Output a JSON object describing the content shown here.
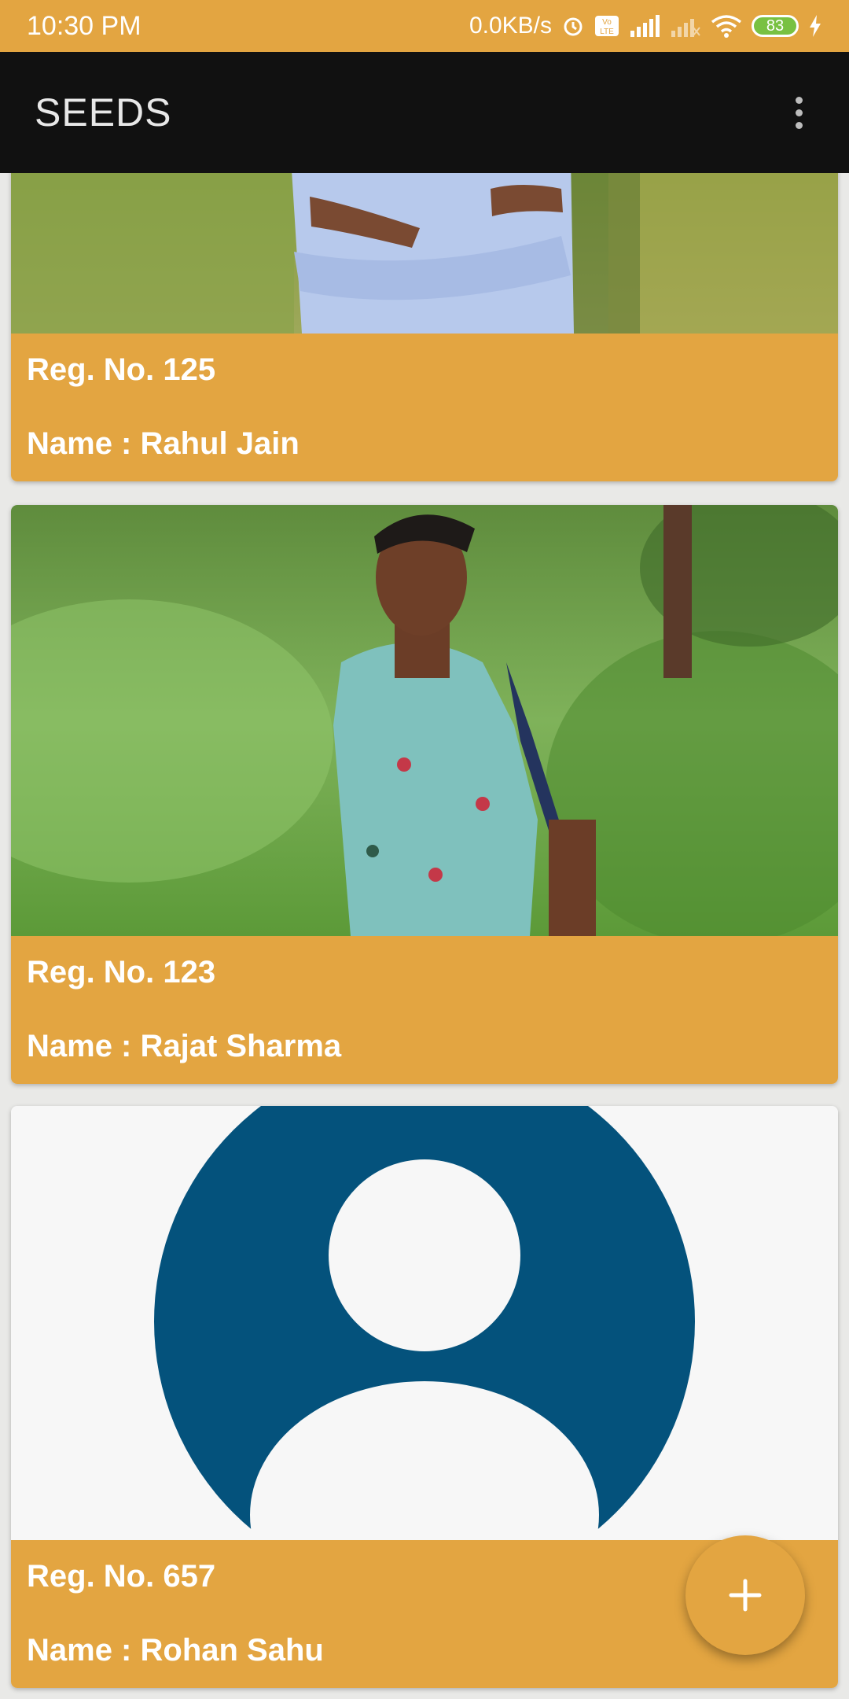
{
  "status_bar": {
    "time": "10:30 PM",
    "network_speed": "0.0KB/s",
    "battery_level": "83",
    "icons": [
      "alarm-icon",
      "volte-icon",
      "signal-icon",
      "signal-no-service-icon",
      "wifi-icon",
      "battery-icon",
      "charging-icon"
    ]
  },
  "app_bar": {
    "title": "SEEDS",
    "menu_icon": "overflow-menu-icon"
  },
  "cards": [
    {
      "reg_label": "Reg. No. 125",
      "name_label": "Name : Rahul Jain",
      "photo": "person-photo"
    },
    {
      "reg_label": "Reg. No. 123",
      "name_label": "Name : Rajat Sharma",
      "photo": "person-photo"
    },
    {
      "reg_label": "Reg. No. 657",
      "name_label": "Name : Rohan Sahu",
      "photo": "default-avatar-icon"
    }
  ],
  "fab": {
    "icon": "plus-icon"
  },
  "colors": {
    "accent": "#e3a541",
    "app_bar": "#111111",
    "avatar": "#04527c"
  }
}
